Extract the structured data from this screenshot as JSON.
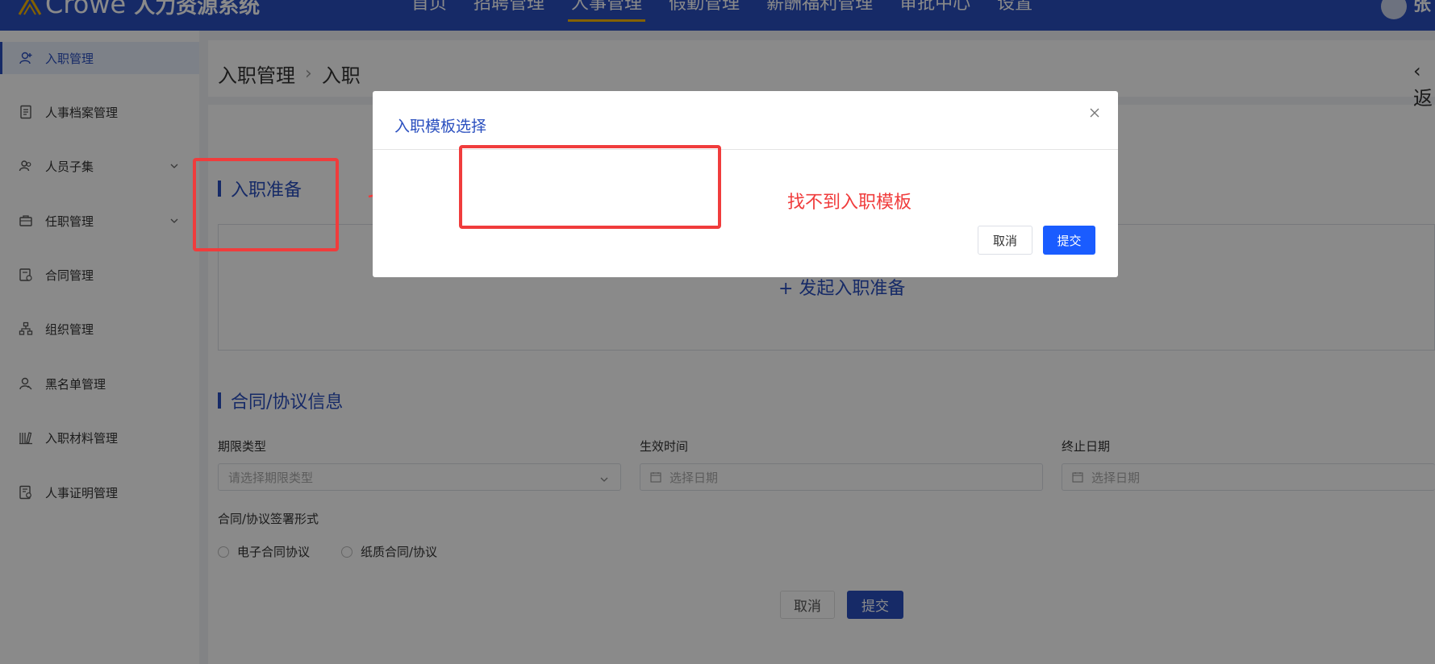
{
  "app": {
    "logo_text": "Crowe",
    "system_name": "人力资源系统",
    "user_initial": "张"
  },
  "nav": {
    "items": [
      "首页",
      "招聘管理",
      "人事管理",
      "假勤管理",
      "薪酬福利管理",
      "审批中心",
      "设置"
    ],
    "active": "人事管理"
  },
  "sidebar": {
    "items": [
      {
        "label": "入职管理",
        "icon": "user-add-icon"
      },
      {
        "label": "人事档案管理",
        "icon": "document-icon"
      },
      {
        "label": "人员子集",
        "icon": "users-icon"
      },
      {
        "label": "任职管理",
        "icon": "briefcase-icon"
      },
      {
        "label": "合同管理",
        "icon": "contract-icon"
      },
      {
        "label": "组织管理",
        "icon": "org-chart-icon"
      },
      {
        "label": "黑名单管理",
        "icon": "user-block-icon"
      },
      {
        "label": "入职材料管理",
        "icon": "books-icon"
      },
      {
        "label": "人事证明管理",
        "icon": "certificate-icon"
      }
    ]
  },
  "breadcrumb": {
    "parent": "入职管理",
    "sep": "›",
    "current": "入职",
    "back": "‹ 返"
  },
  "sections": {
    "prep_title": "入职准备",
    "prep_action": "+ 发起入职准备",
    "contract_title": "合同/协议信息"
  },
  "form": {
    "term_type_label": "期限类型",
    "term_type_placeholder": "请选择期限类型",
    "effective_label": "生效时间",
    "effective_placeholder": "选择日期",
    "end_label": "终止日期",
    "end_placeholder": "选择日期",
    "sign_form_label": "合同/协议签署形式",
    "sign_options": [
      "电子合同协议",
      "纸质合同/协议"
    ],
    "cancel": "取消",
    "submit": "提交"
  },
  "modal": {
    "title": "入职模板选择",
    "cancel": "取消",
    "submit": "提交"
  },
  "annotation": {
    "note": "找不到入职模板",
    "color": "#f03c3c"
  },
  "colors": {
    "brand": "#2a4fbf",
    "primary_button": "#1a5cff"
  }
}
